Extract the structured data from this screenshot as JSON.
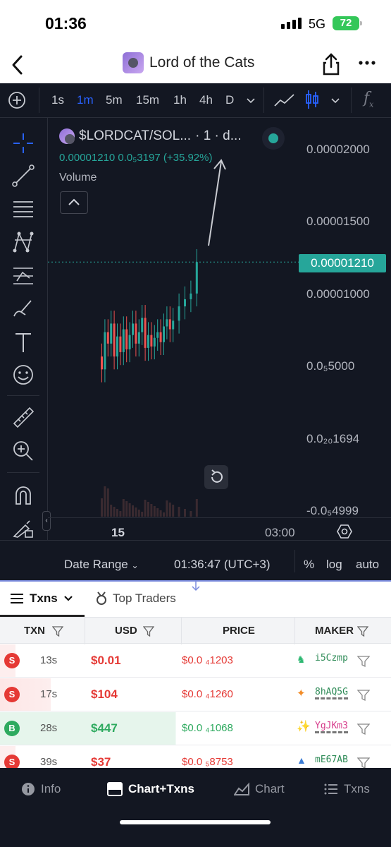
{
  "status_bar": {
    "time": "01:36",
    "network": "5G",
    "battery": "72"
  },
  "header": {
    "title": "Lord of the Cats",
    "back_icon": "chevron-left-icon",
    "share_icon": "share-icon",
    "more_icon": "more-icon"
  },
  "timeframes": [
    "1s",
    "1m",
    "5m",
    "15m",
    "1h",
    "4h",
    "D"
  ],
  "active_timeframe": "1m",
  "chart": {
    "symbol": "$LORDCAT/SOL...",
    "interval_text": "· 1 · d...",
    "ohlc_text": "0.00001210  0.0₅3197 (+35.92%)",
    "volume_label": "Volume",
    "price_labels": [
      "0.00002000",
      "0.00001500",
      "0.00001000",
      "0.0₅5000",
      "0.0₂₀1694",
      "-0.0₅4999"
    ],
    "current_price": "0.00001210",
    "time_labels": [
      "15",
      "03:00"
    ],
    "up_color": "#26a69a",
    "down_color": "#ef5350"
  },
  "chart_data": {
    "type": "candlestick",
    "title": "$LORDCAT/SOL",
    "ylabel": "",
    "xlabel": "",
    "ylim": [
      -5e-06,
      2.2e-05
    ],
    "series": [
      {
        "name": "$LORDCAT/SOL",
        "close": [
          4.6e-06,
          7.2e-06,
          6.4e-06,
          7.8e-06,
          5.5e-06,
          6.9e-06,
          5.8e-06,
          7.4e-06,
          6e-06,
          7e-06,
          7.8e-06,
          6.4e-06,
          7.2e-06,
          8.2e-06,
          6.1e-06,
          7e-06,
          6.2e-06,
          6.8e-06,
          7.2e-06,
          6.5e-06,
          7.6e-06,
          8.1e-06,
          7.4e-06,
          8e-06,
          9e-06,
          9.5e-06,
          9.9e-06,
          1.21e-05
        ]
      }
    ],
    "current": 1.21e-05
  },
  "chart_footer": {
    "date_range": "Date Range",
    "clock": "01:36:47 (UTC+3)",
    "percent": "%",
    "log": "log",
    "auto": "auto"
  },
  "panel_tabs": {
    "txns": "Txns",
    "top_traders": "Top Traders"
  },
  "table": {
    "headers": [
      "TXN",
      "USD",
      "PRICE",
      "MAKER"
    ],
    "rows": [
      {
        "type": "S",
        "age": "13s",
        "usd": "$0.01",
        "price": "$0.0 ₄1203",
        "maker": "i5Czmp"
      },
      {
        "type": "S",
        "age": "17s",
        "usd": "$104",
        "price": "$0.0 ₄1260",
        "maker": "8hAQ5G"
      },
      {
        "type": "B",
        "age": "28s",
        "usd": "$447",
        "price": "$0.0 ₄1068",
        "maker": "YgJKm3"
      },
      {
        "type": "S",
        "age": "39s",
        "usd": "$37",
        "price": "$0.0 ₅8753",
        "maker": "mE67AB"
      }
    ]
  },
  "bottom_nav": [
    "Info",
    "Chart+Txns",
    "Chart",
    "Txns"
  ],
  "bottom_nav_active": "Chart+Txns"
}
